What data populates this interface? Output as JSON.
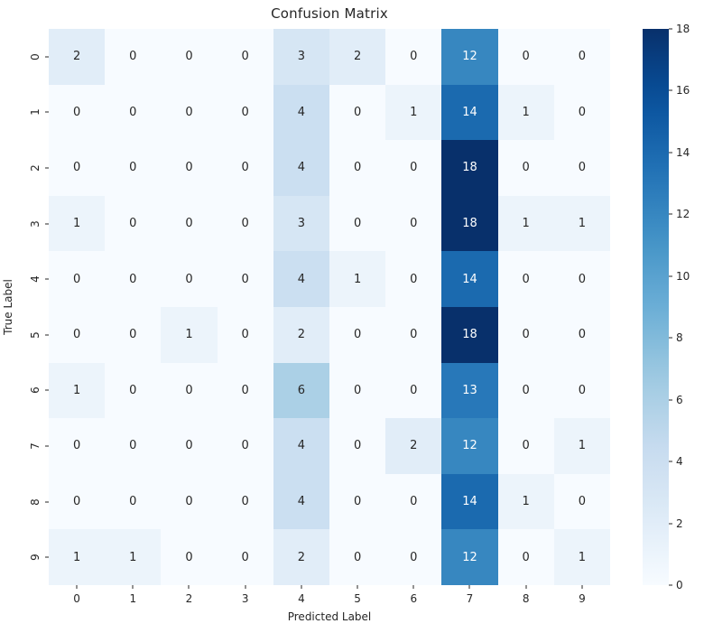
{
  "chart_data": {
    "type": "heatmap",
    "title": "Confusion Matrix",
    "xlabel": "Predicted Label",
    "ylabel": "True Label",
    "x_tick_labels": [
      "0",
      "1",
      "2",
      "3",
      "4",
      "5",
      "6",
      "7",
      "8",
      "9"
    ],
    "y_tick_labels": [
      "0",
      "1",
      "2",
      "3",
      "4",
      "5",
      "6",
      "7",
      "8",
      "9"
    ],
    "categories": [
      "0",
      "1",
      "2",
      "3",
      "4",
      "5",
      "6",
      "7",
      "8",
      "9"
    ],
    "matrix": [
      [
        2,
        0,
        0,
        0,
        3,
        2,
        0,
        12,
        0,
        0
      ],
      [
        0,
        0,
        0,
        0,
        4,
        0,
        1,
        14,
        1,
        0
      ],
      [
        0,
        0,
        0,
        0,
        4,
        0,
        0,
        18,
        0,
        0
      ],
      [
        1,
        0,
        0,
        0,
        3,
        0,
        0,
        18,
        1,
        1
      ],
      [
        0,
        0,
        0,
        0,
        4,
        1,
        0,
        14,
        0,
        0
      ],
      [
        0,
        0,
        1,
        0,
        2,
        0,
        0,
        18,
        0,
        0
      ],
      [
        1,
        0,
        0,
        0,
        6,
        0,
        0,
        13,
        0,
        0
      ],
      [
        0,
        0,
        0,
        0,
        4,
        0,
        2,
        12,
        0,
        1
      ],
      [
        0,
        0,
        0,
        0,
        4,
        0,
        0,
        14,
        1,
        0
      ],
      [
        1,
        1,
        0,
        0,
        2,
        0,
        0,
        12,
        0,
        1
      ]
    ],
    "vmin": 0,
    "vmax": 18,
    "colormap": "Blues",
    "colorbar": {
      "position": "right",
      "ticks": [
        0,
        2,
        4,
        6,
        8,
        10,
        12,
        14,
        16,
        18
      ],
      "tick_labels": [
        "0",
        "2",
        "4",
        "6",
        "8",
        "10",
        "12",
        "14",
        "16",
        "18"
      ],
      "gradient_stops": [
        "#f7fbff",
        "#deebf7",
        "#c6dbef",
        "#9ecae1",
        "#6baed6",
        "#4292c6",
        "#2171b5",
        "#08519c",
        "#08306b"
      ]
    },
    "grid": false,
    "annotations_text_light_threshold": 10,
    "text_color_dark": "#262626",
    "text_color_light": "#ffffff",
    "background": "#ffffff"
  }
}
